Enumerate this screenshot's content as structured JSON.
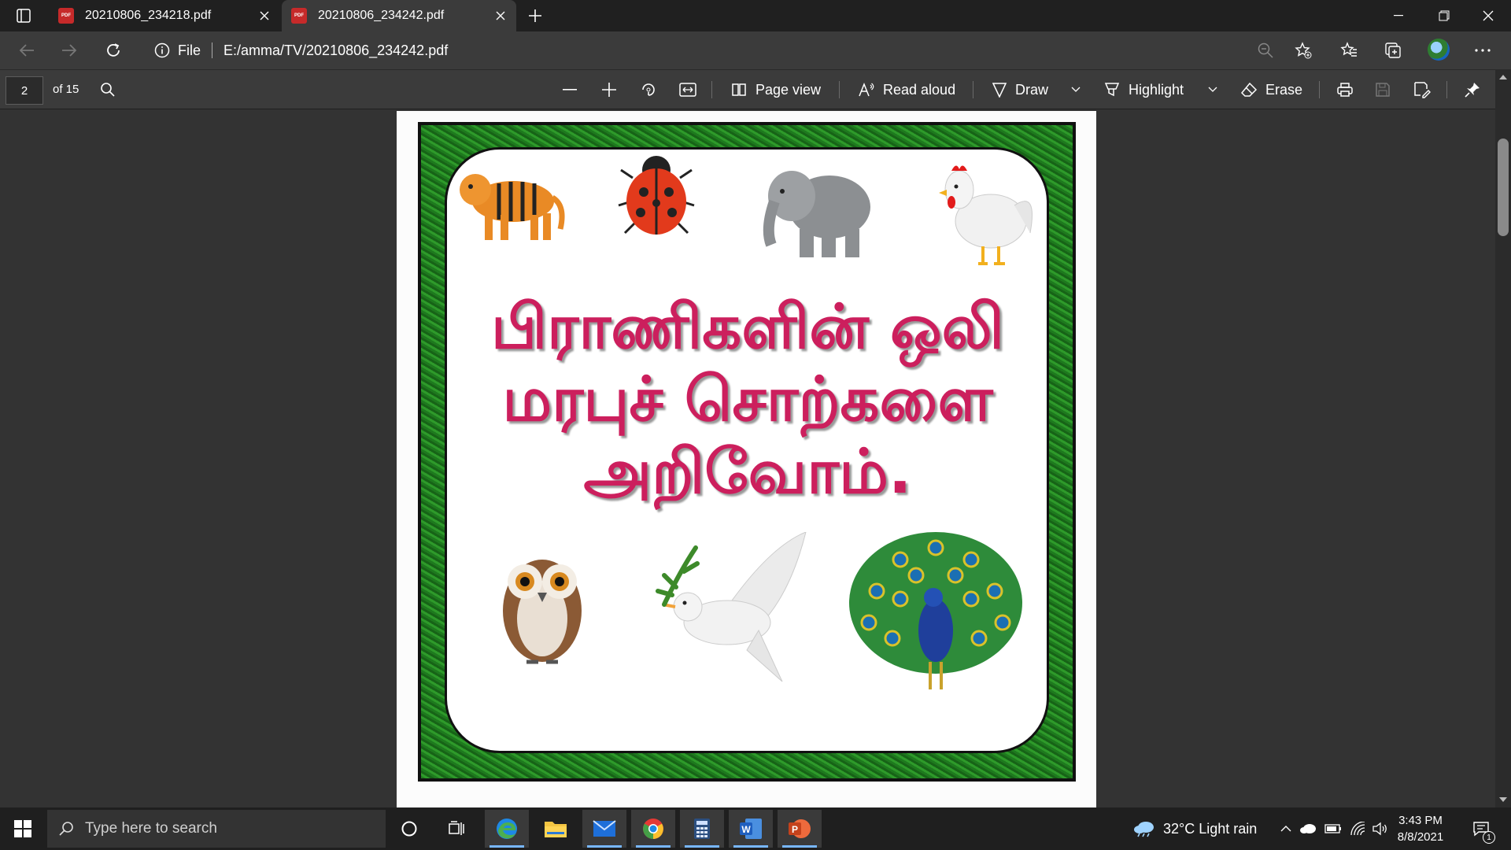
{
  "browser": {
    "tabs": [
      {
        "label": "20210806_234218.pdf",
        "icon": "pdf-icon",
        "active": false
      },
      {
        "label": "20210806_234242.pdf",
        "icon": "pdf-icon",
        "active": true
      }
    ],
    "address": {
      "scheme_label": "File",
      "url": "E:/amma/TV/20210806_234242.pdf"
    }
  },
  "pdf_toolbar": {
    "page_number": "2",
    "page_count": "of 15",
    "page_view_label": "Page view",
    "read_aloud_label": "Read aloud",
    "draw_label": "Draw",
    "highlight_label": "Highlight",
    "erase_label": "Erase"
  },
  "document": {
    "title_lines": [
      "பிராணிகளின் ஒலி",
      "மரபுச் சொற்களை",
      "அறிவோம்."
    ],
    "animals_top": [
      "tiger-icon",
      "ladybug-icon",
      "elephant-icon",
      "rooster-icon"
    ],
    "animals_bottom": [
      "owl-icon",
      "dove-icon",
      "peacock-icon"
    ],
    "title_color": "#cc1f5d",
    "border_color": "#2e9a2a"
  },
  "taskbar": {
    "search_placeholder": "Type here to search",
    "weather": "32°C  Light rain",
    "time": "3:43 PM",
    "date": "8/8/2021",
    "notification_count": "1"
  }
}
